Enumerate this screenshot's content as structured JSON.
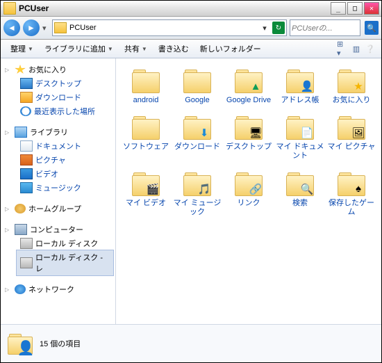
{
  "title": "PCUser",
  "address": "PCUser",
  "searchPlaceholder": "PCUserの...",
  "toolbar": {
    "organize": "整理",
    "library": "ライブラリに追加",
    "share": "共有",
    "burn": "書き込む",
    "newfolder": "新しいフォルダー"
  },
  "sidebar": {
    "fav": {
      "label": "お気に入り",
      "items": [
        {
          "label": "デスクトップ",
          "cls": "i-desk"
        },
        {
          "label": "ダウンロード",
          "cls": "i-dl"
        },
        {
          "label": "最近表示した場所",
          "cls": "i-clock"
        }
      ]
    },
    "lib": {
      "label": "ライブラリ",
      "items": [
        {
          "label": "ドキュメント",
          "cls": "i-doc"
        },
        {
          "label": "ピクチャ",
          "cls": "i-pic"
        },
        {
          "label": "ビデオ",
          "cls": "i-vid"
        },
        {
          "label": "ミュージック",
          "cls": "i-mus"
        }
      ]
    },
    "hg": {
      "label": "ホームグループ"
    },
    "comp": {
      "label": "コンピューター",
      "items": [
        {
          "label": "ローカル ディスク",
          "cls": "i-drive"
        },
        {
          "label": "ローカル ディスク - レ",
          "cls": "i-drive",
          "sel": true
        }
      ]
    },
    "net": {
      "label": "ネットワーク"
    }
  },
  "items": [
    {
      "label": "android",
      "ov": ""
    },
    {
      "label": "Google",
      "ov": ""
    },
    {
      "label": "Google Drive",
      "ov": "▲",
      "ovc": "#0f9d58"
    },
    {
      "label": "アドレス帳",
      "ov": "👤",
      "ovc": ""
    },
    {
      "label": "お気に入り",
      "ov": "★",
      "ovc": "#f5b400"
    },
    {
      "label": "ソフトウェア",
      "ov": ""
    },
    {
      "label": "ダウンロード",
      "ov": "⬇",
      "ovc": "#1a8ad8"
    },
    {
      "label": "デスクトップ",
      "ov": "🖥",
      "ovc": ""
    },
    {
      "label": "マイ ドキュメント",
      "ov": "📄",
      "ovc": ""
    },
    {
      "label": "マイ ピクチャ",
      "ov": "🖼",
      "ovc": ""
    },
    {
      "label": "マイ ビデオ",
      "ov": "🎬",
      "ovc": ""
    },
    {
      "label": "マイ ミュージック",
      "ov": "🎵",
      "ovc": "#1a8ad8"
    },
    {
      "label": "リンク",
      "ov": "🔗",
      "ovc": ""
    },
    {
      "label": "検索",
      "ov": "🔍",
      "ovc": ""
    },
    {
      "label": "保存したゲーム",
      "ov": "♠",
      "ovc": "#000"
    }
  ],
  "status": "15 個の項目"
}
